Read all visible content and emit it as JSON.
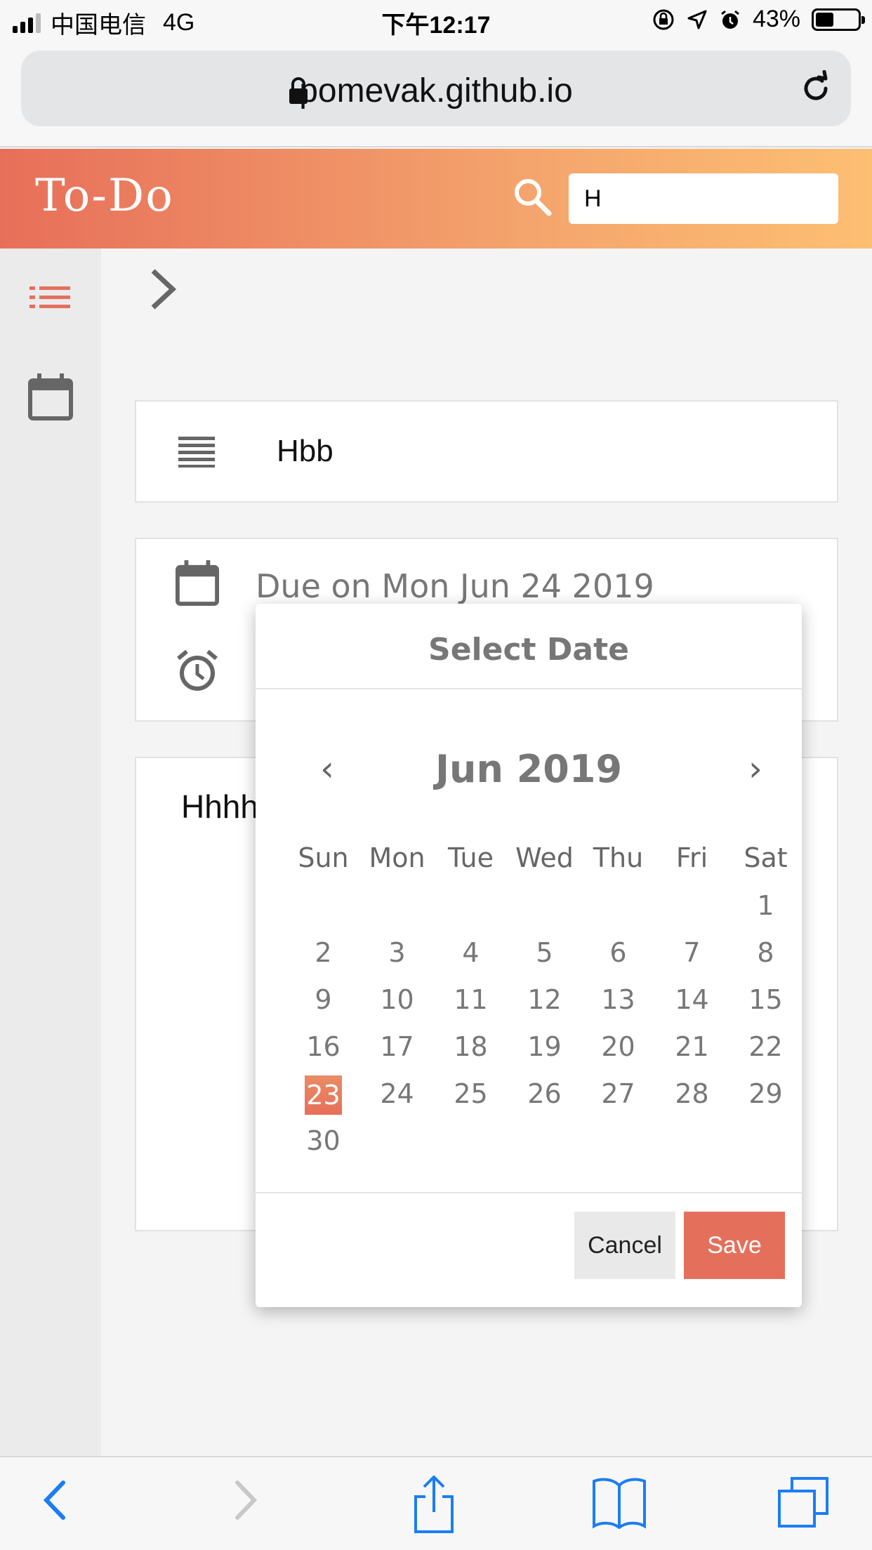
{
  "status_bar": {
    "carrier": "中国电信",
    "network": "4G",
    "time": "下午12:17",
    "battery": "43%",
    "battery_level": 0.43
  },
  "browser": {
    "url": "pomevak.github.io"
  },
  "header": {
    "brand": "To-Do",
    "search_value": "H"
  },
  "task": {
    "title": "Hbb",
    "due": "Due on Mon Jun 24 2019",
    "notes": "Hhhh"
  },
  "date_picker": {
    "title": "Select Date",
    "month": "Jun 2019",
    "prev": "‹",
    "next": "›",
    "weekdays": [
      "Sun",
      "Mon",
      "Tue",
      "Wed",
      "Thu",
      "Fri",
      "Sat"
    ],
    "days": [
      "",
      "",
      "",
      "",
      "",
      "",
      "1",
      "2",
      "3",
      "4",
      "5",
      "6",
      "7",
      "8",
      "9",
      "10",
      "11",
      "12",
      "13",
      "14",
      "15",
      "16",
      "17",
      "18",
      "19",
      "20",
      "21",
      "22",
      "23",
      "24",
      "25",
      "26",
      "27",
      "28",
      "29",
      "30"
    ],
    "selected": "23",
    "cancel": "Cancel",
    "save": "Save"
  },
  "colors": {
    "accent": "#e4705c",
    "gradient_start": "#e76f59",
    "gradient_end": "#fdbf72",
    "ios_blue": "#1a7ef2"
  },
  "icons": [
    "lock-icon",
    "reload-icon",
    "search-icon",
    "list-icon",
    "calendar-icon",
    "chevron-right-icon",
    "lines-icon",
    "alarm-icon",
    "back-icon",
    "forward-icon",
    "share-icon",
    "bookmarks-icon",
    "tabs-icon"
  ]
}
